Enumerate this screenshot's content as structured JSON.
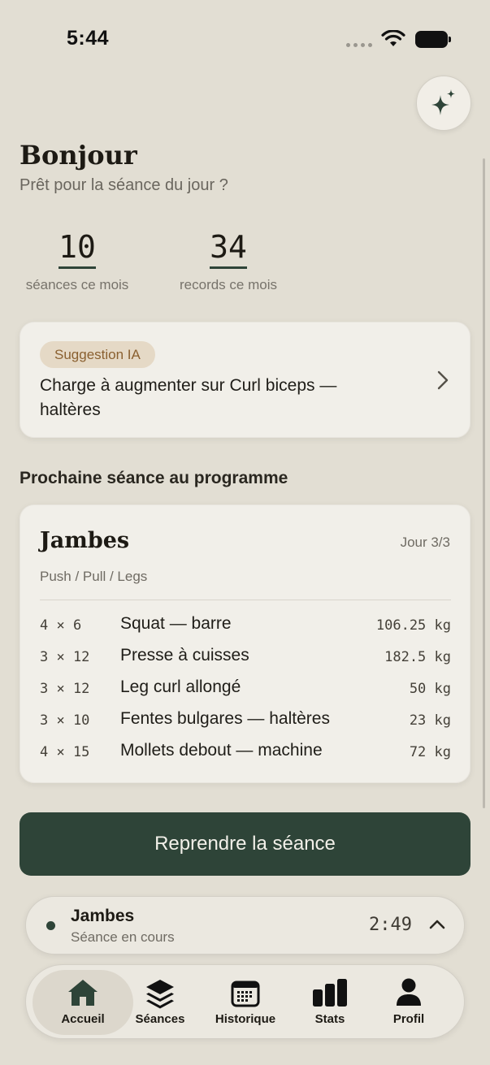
{
  "status_bar": {
    "time": "5:44"
  },
  "header": {
    "greeting": "Bonjour",
    "subtitle": "Prêt pour la séance du jour ?"
  },
  "stats": [
    {
      "value": "10",
      "label": "séances ce mois"
    },
    {
      "value": "34",
      "label": "records ce mois"
    }
  ],
  "suggestion": {
    "badge": "Suggestion IA",
    "text": "Charge à augmenter sur Curl biceps — haltères"
  },
  "next_session": {
    "section_title": "Prochaine séance au programme",
    "title": "Jambes",
    "day": "Jour 3/3",
    "split": "Push / Pull / Legs",
    "exercises": [
      {
        "sets": "4 × 6",
        "name": "Squat — barre",
        "load": "106.25 kg"
      },
      {
        "sets": "3 × 12",
        "name": "Presse à cuisses",
        "load": "182.5 kg"
      },
      {
        "sets": "3 × 12",
        "name": "Leg curl allongé",
        "load": "50 kg"
      },
      {
        "sets": "3 × 10",
        "name": "Fentes bulgares — haltères",
        "load": "23 kg"
      },
      {
        "sets": "4 × 15",
        "name": "Mollets debout — machine",
        "load": "72 kg"
      }
    ]
  },
  "resume_button": "Reprendre la séance",
  "live_session": {
    "name": "Jambes",
    "status": "Séance en cours",
    "timer": "2:49"
  },
  "tabs": [
    {
      "label": "Accueil",
      "icon": "home-icon",
      "active": true
    },
    {
      "label": "Séances",
      "icon": "layers-icon",
      "active": false
    },
    {
      "label": "Historique",
      "icon": "calendar-icon",
      "active": false
    },
    {
      "label": "Stats",
      "icon": "bar-chart-icon",
      "active": false
    },
    {
      "label": "Profil",
      "icon": "person-icon",
      "active": false
    }
  ],
  "colors": {
    "background": "#e2ded3",
    "card": "#f1efe9",
    "accent": "#2e4438",
    "badge_bg": "#e5d9c6",
    "badge_text": "#8a6030"
  }
}
